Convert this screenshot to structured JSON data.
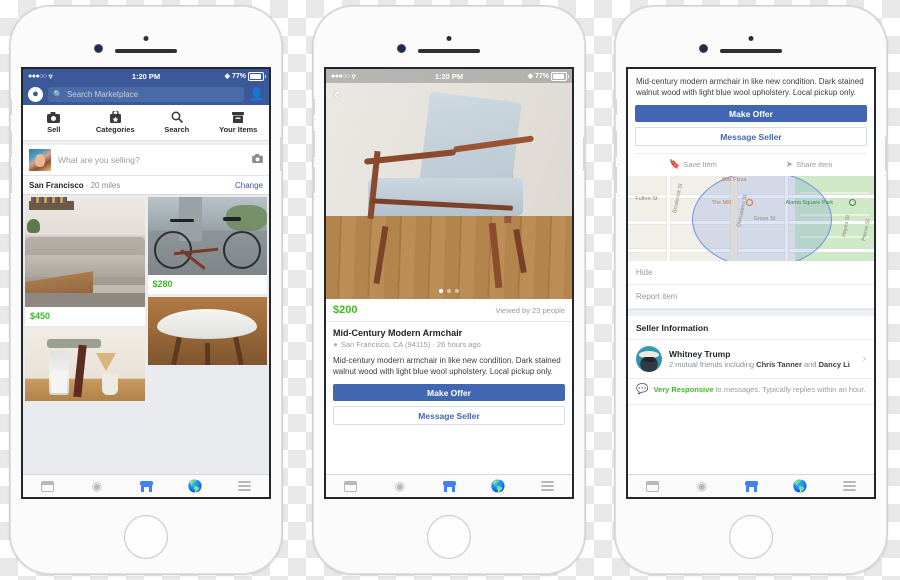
{
  "statusbar": {
    "time": "1:20 PM",
    "battery": "77%",
    "signal_dots": "●●●○○",
    "wifi_icon": "wifi-icon",
    "bluetooth_icon": "bluetooth-icon"
  },
  "phone1": {
    "header": {
      "messenger_icon": "messenger-icon",
      "search_placeholder": "Search Marketplace",
      "search_icon": "search-icon",
      "friends_icon": "friend-requests-icon"
    },
    "quicknav": [
      {
        "label": "Sell",
        "icon": "camera-icon"
      },
      {
        "label": "Categories",
        "icon": "categories-box-icon"
      },
      {
        "label": "Search",
        "icon": "search-icon"
      },
      {
        "label": "Your Items",
        "icon": "archive-box-icon"
      }
    ],
    "composer": {
      "placeholder": "What are you selling?",
      "avatar": "user-avatar",
      "camera_icon": "camera-icon"
    },
    "location": {
      "city": "San Francisco",
      "distance": "· 20 miles",
      "change_label": "Change"
    },
    "listings_left": [
      {
        "price": "$450",
        "image": "gray-tufted-sofa-living-room"
      },
      {
        "price": "",
        "image": "chemex-coffee-brewer"
      }
    ],
    "listings_right": [
      {
        "price": "$280",
        "image": "copper-road-bicycle"
      },
      {
        "price": "",
        "image": "white-bowl-wood-stand-table"
      }
    ]
  },
  "phone2": {
    "back_icon": "back-chevron-icon",
    "hero_image": "mid-century-armchair-photo",
    "carousel_dots": 3,
    "carousel_active": 0,
    "price": "$200",
    "views": "Viewed by 23 people",
    "title": "Mid-Century Modern Armchair",
    "location_icon": "location-pin-icon",
    "meta": "San Francisco, CA (94115) · 26 hours ago",
    "description": "Mid-century modern armchair in like new condition. Dark stained walnut wood with light blue wool upholstery. Local pickup only.",
    "primary_button": "Make Offer",
    "secondary_button": "Message Seller"
  },
  "phone3": {
    "description": "Mid-century modern armchair in like new condition. Dark stained walnut wood with light blue wool upholstery. Local pickup only.",
    "primary_button": "Make Offer",
    "secondary_button": "Message Seller",
    "actions": [
      {
        "label": "Save Item",
        "icon": "bookmark-icon"
      },
      {
        "label": "Share item",
        "icon": "share-arrow-icon"
      }
    ],
    "map": {
      "labels": [
        "Fulton St",
        "Broderick St",
        "Grove St",
        "Divisadero St",
        "Hayes St",
        "Pierce St"
      ],
      "poi_the_mill": "The Mill",
      "poi_pizza": "Star Pizza",
      "poi_park": "Alamo Square Park"
    },
    "list_items": [
      "Hide",
      "Report item"
    ],
    "seller_section_title": "Seller Information",
    "seller": {
      "name": "Whitney Trump",
      "mutual_line1": "2 mutual friends including",
      "mutual_bold1": "Chris Tanner",
      "mutual_line2": "and",
      "mutual_bold2": "Dancy Li",
      "chevron_icon": "chevron-right-icon",
      "avatar": "seller-avatar"
    },
    "responsiveness": {
      "icon": "speech-bubble-icon",
      "badge": "Very Responsive",
      "text": " to messages. Typically replies within an hour."
    }
  },
  "tabbar": [
    {
      "icon": "news-feed-icon",
      "active": false
    },
    {
      "icon": "video-play-icon",
      "active": false
    },
    {
      "icon": "marketplace-store-icon",
      "active": true
    },
    {
      "icon": "globe-notifications-icon",
      "active": false
    },
    {
      "icon": "hamburger-menu-icon",
      "active": false
    }
  ],
  "colors": {
    "fb_blue": "#3b5998",
    "button_blue": "#4267b2",
    "price_green": "#42b72a",
    "link_blue": "#3b5998",
    "active_tab": "#4080ff"
  }
}
